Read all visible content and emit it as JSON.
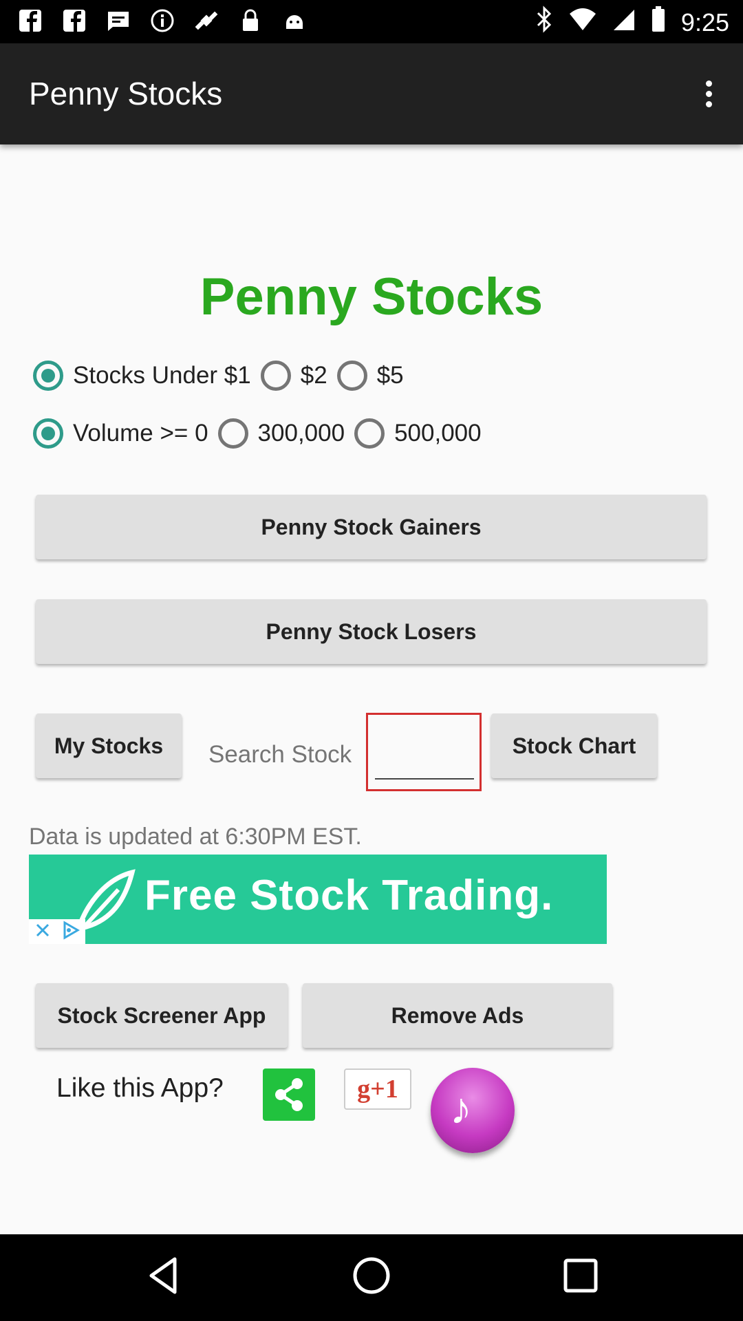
{
  "status_bar": {
    "time": "9:25",
    "icons_left": [
      "facebook-icon",
      "facebook-icon",
      "message-icon",
      "info-icon",
      "satellite-icon",
      "lock-icon",
      "android-icon"
    ],
    "icons_right": [
      "bluetooth-icon",
      "wifi-icon",
      "signal-icon",
      "battery-icon"
    ]
  },
  "appbar": {
    "title": "Penny Stocks"
  },
  "main": {
    "heading": "Penny Stocks",
    "price_filters": [
      {
        "label": "Stocks Under $1",
        "checked": true
      },
      {
        "label": "$2",
        "checked": false
      },
      {
        "label": "$5",
        "checked": false
      }
    ],
    "volume_filters": [
      {
        "label": "Volume >= 0",
        "checked": true
      },
      {
        "label": "300,000",
        "checked": false
      },
      {
        "label": "500,000",
        "checked": false
      }
    ],
    "gainers_button": "Penny Stock Gainers",
    "losers_button": "Penny Stock Losers",
    "my_stocks_button": "My Stocks",
    "search_label": "Search Stock",
    "search_value": "",
    "stock_chart_button": "Stock Chart",
    "updated_text": "Data is updated at 6:30PM EST.",
    "ad_text": "Free Stock Trading.",
    "screener_button": "Stock Screener App",
    "remove_ads_button": "Remove Ads",
    "like_text": "Like this App?",
    "gplus_text": "g+1"
  },
  "colors": {
    "heading_green": "#2aa81f",
    "radio_teal": "#2e9b8a",
    "ad_green": "#26c997",
    "share_green": "#21c23e"
  }
}
